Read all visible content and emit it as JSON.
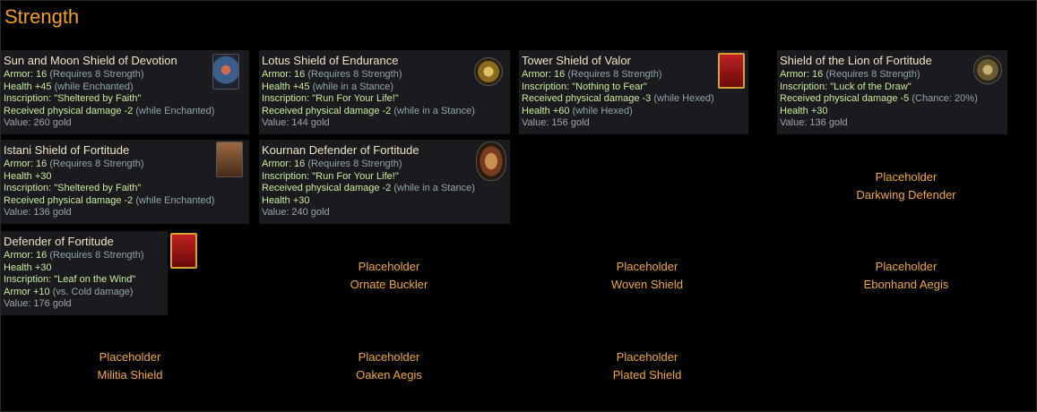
{
  "page": {
    "title": "Strength"
  },
  "cards": [
    {
      "name": "Sun and Moon Shield of Devotion",
      "icon": "sun-moon-shield-icon",
      "lines": [
        {
          "main": "Armor: 16",
          "extra": " (Requires 8 Strength)"
        },
        {
          "main": "Health +45",
          "extra": " (while Enchanted)"
        },
        {
          "main": "Inscription: \"Sheltered by Faith\"",
          "extra": ""
        },
        {
          "main": "Received physical damage -2",
          "extra": " (while Enchanted)"
        }
      ],
      "value": "Value: 260 gold"
    },
    {
      "name": "Lotus Shield of Endurance",
      "icon": "lotus-shield-icon",
      "lines": [
        {
          "main": "Armor: 16",
          "extra": " (Requires 8 Strength)"
        },
        {
          "main": "Health +45",
          "extra": " (while in a Stance)"
        },
        {
          "main": "Inscription: \"Run For Your Life!\"",
          "extra": ""
        },
        {
          "main": "Received physical damage -2",
          "extra": " (while in a Stance)"
        }
      ],
      "value": "Value: 144 gold"
    },
    {
      "name": "Tower Shield of Valor",
      "icon": "tower-shield-icon",
      "lines": [
        {
          "main": "Armor: 16",
          "extra": " (Requires 8 Strength)"
        },
        {
          "main": "Inscription: \"Nothing to Fear\"",
          "extra": ""
        },
        {
          "main": "Received physical damage -3",
          "extra": " (while Hexed)"
        },
        {
          "main": "Health +60",
          "extra": " (while Hexed)"
        }
      ],
      "value": "Value: 156 gold"
    },
    {
      "name": "Shield of the Lion of Fortitude",
      "icon": "lion-shield-icon",
      "lines": [
        {
          "main": "Armor: 16",
          "extra": " (Requires 8 Strength)"
        },
        {
          "main": "Inscription: \"Luck of the Draw\"",
          "extra": ""
        },
        {
          "main": "Received physical damage -5",
          "extra": " (Chance: 20%)"
        },
        {
          "main": "Health +30",
          "extra": ""
        }
      ],
      "value": "Value: 136 gold"
    },
    {
      "name": "Istani Shield of Fortitude",
      "icon": "istani-shield-icon",
      "lines": [
        {
          "main": "Armor: 16",
          "extra": " (Requires 8 Strength)"
        },
        {
          "main": "Health +30",
          "extra": ""
        },
        {
          "main": "Inscription: \"Sheltered by Faith\"",
          "extra": ""
        },
        {
          "main": "Received physical damage -2",
          "extra": " (while Enchanted)"
        }
      ],
      "value": "Value: 136 gold"
    },
    {
      "name": "Kournan Defender of Fortitude",
      "icon": "kournan-defender-icon",
      "lines": [
        {
          "main": "Armor: 16",
          "extra": " (Requires 8 Strength)"
        },
        {
          "main": "Inscription: \"Run For Your Life!\"",
          "extra": ""
        },
        {
          "main": "Received physical damage -2",
          "extra": " (while in a Stance)"
        },
        {
          "main": "Health +30",
          "extra": ""
        }
      ],
      "value": "Value: 240 gold"
    },
    {
      "name": "Defender of Fortitude",
      "icon": "defender-shield-icon",
      "lines": [
        {
          "main": "Armor: 16",
          "extra": " (Requires 8 Strength)"
        },
        {
          "main": "Health +30",
          "extra": ""
        },
        {
          "main": "Inscription: \"Leaf on the Wind\"",
          "extra": ""
        },
        {
          "main": "Armor +10",
          "extra": " (vs. Cold damage)"
        }
      ],
      "value": "Value: 176 gold"
    }
  ],
  "placeholders": [
    {
      "label": "Placeholder",
      "name": "Darkwing Defender"
    },
    {
      "label": "Placeholder",
      "name": "Ornate Buckler"
    },
    {
      "label": "Placeholder",
      "name": "Woven Shield"
    },
    {
      "label": "Placeholder",
      "name": "Ebonhand Aegis"
    },
    {
      "label": "Placeholder",
      "name": "Militia Shield"
    },
    {
      "label": "Placeholder",
      "name": "Oaken Aegis"
    },
    {
      "label": "Placeholder",
      "name": "Plated Shield"
    }
  ]
}
